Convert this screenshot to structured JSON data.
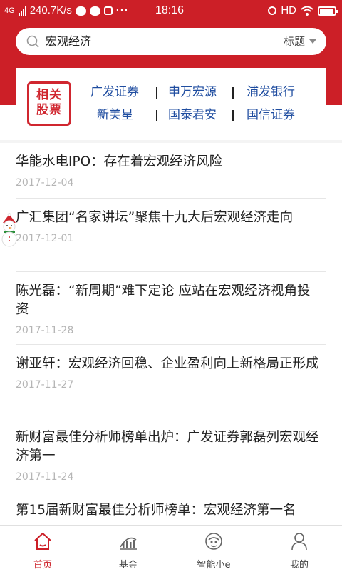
{
  "status_bar": {
    "network": "4G",
    "speed": "240.7K/s",
    "time": "18:16",
    "hd": "HD",
    "battery_level": 0.9
  },
  "search": {
    "query": "宏观经济",
    "scope": "标题",
    "icon": "search-icon"
  },
  "related": {
    "badge_line1": "相关",
    "badge_line2": "股票",
    "stocks": [
      "广发证券",
      "申万宏源",
      "浦发银行",
      "新美星",
      "国泰君安",
      "国信证券"
    ]
  },
  "news": [
    {
      "title": "华能水电IPO：存在着宏观经济风险",
      "date": "2017-12-04"
    },
    {
      "title": "广汇集团“名家讲坛”聚焦十九大后宏观经济走向",
      "date": "2017-12-01"
    },
    {
      "title": "陈光磊：“新周期”难下定论 应站在宏观经济视角投资",
      "date": "2017-11-28"
    },
    {
      "title": "谢亚轩：宏观经济回稳、企业盈利向上新格局正形成",
      "date": "2017-11-27"
    },
    {
      "title": "新财富最佳分析师榜单出炉：广发证券郭磊列宏观经济第一",
      "date": "2017-11-24"
    },
    {
      "title": "第15届新财富最佳分析师榜单：宏观经济第一名",
      "date": ""
    }
  ],
  "bottom_nav": [
    {
      "label": "首页",
      "icon": "home-icon",
      "active": true
    },
    {
      "label": "基金",
      "icon": "fund-chart-icon",
      "active": false
    },
    {
      "label": "智能小e",
      "icon": "robot-icon",
      "active": false
    },
    {
      "label": "我的",
      "icon": "person-icon",
      "active": false
    }
  ],
  "colors": {
    "brand_red": "#cc1f27",
    "stock_blue": "#1f4da0",
    "date_gray": "#b5b5b5"
  }
}
